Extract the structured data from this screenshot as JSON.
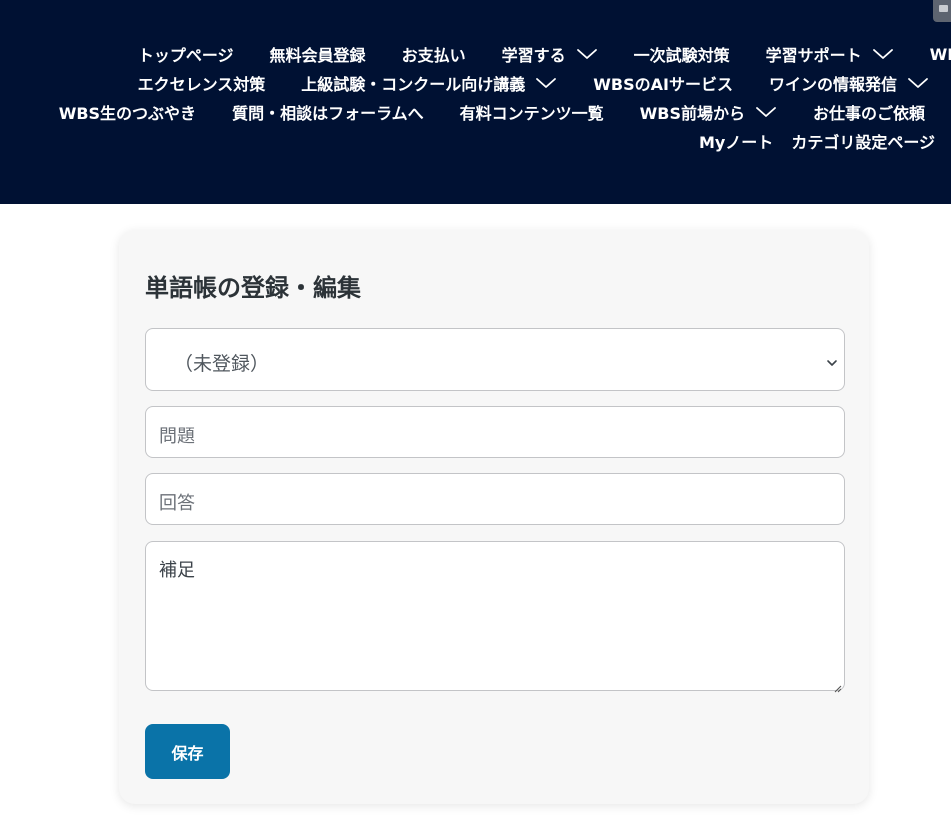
{
  "header": {
    "nav_rows": [
      [
        {
          "label": "トップページ",
          "dropdown": false
        },
        {
          "label": "無料会員登録",
          "dropdown": false
        },
        {
          "label": "お支払い",
          "dropdown": false
        },
        {
          "label": "学習する",
          "dropdown": true
        },
        {
          "label": "一次試験対策",
          "dropdown": false
        },
        {
          "label": "学習サポート",
          "dropdown": true
        },
        {
          "label": "WBS",
          "dropdown": false
        }
      ],
      [
        {
          "label": "エクセレンス対策",
          "dropdown": false
        },
        {
          "label": "上級試験・コンクール向け講義",
          "dropdown": true
        },
        {
          "label": "WBSのAIサービス",
          "dropdown": false
        },
        {
          "label": "ワインの情報発信",
          "dropdown": true
        }
      ],
      [
        {
          "label": "WBS生のつぶやき",
          "dropdown": false
        },
        {
          "label": "質問・相談はフォーラムへ",
          "dropdown": false
        },
        {
          "label": "有料コンテンツ一覧",
          "dropdown": false
        },
        {
          "label": "WBS前場から",
          "dropdown": true
        },
        {
          "label": "お仕事のご依頼",
          "dropdown": false
        }
      ],
      [
        {
          "label": "Myノート",
          "dropdown": false
        },
        {
          "label": "カテゴリ設定ページ",
          "dropdown": false
        }
      ]
    ],
    "corner_icon": "comment-icon"
  },
  "form": {
    "title": "単語帳の登録・編集",
    "select_value": "（未登録）",
    "question_placeholder": "問題",
    "answer_placeholder": "回答",
    "note_placeholder": "補足",
    "save_label": "保存"
  },
  "colors": {
    "header_bg": "#001133",
    "nav_text": "#ffffff",
    "button_bg": "#0a73a8",
    "card_bg": "#f7f7f7"
  }
}
